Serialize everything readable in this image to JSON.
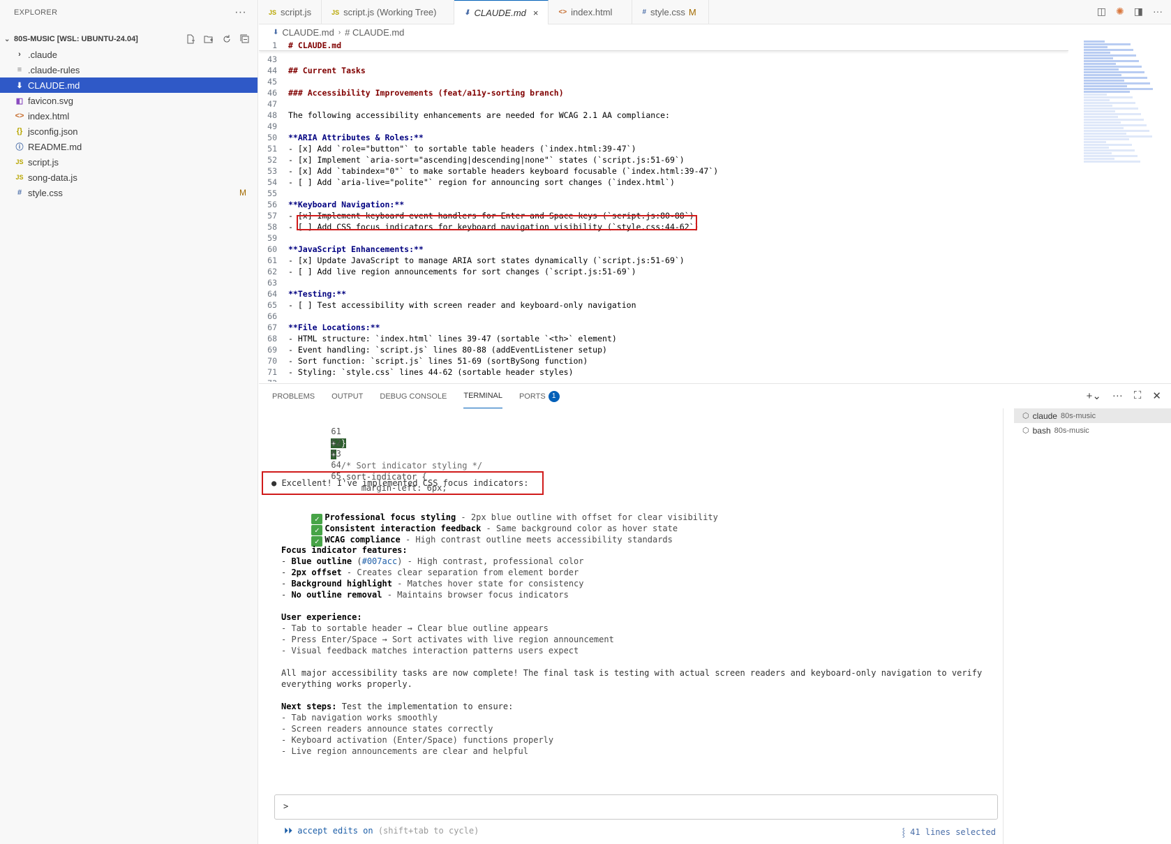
{
  "sidebar": {
    "title": "EXPLORER",
    "more": "···",
    "workspace": "80S-MUSIC [WSL: UBUNTU-24.04]",
    "items": [
      {
        "label": ".claude",
        "icon": "chevron-right"
      },
      {
        "label": ".claude-rules",
        "icon": "rules-file"
      },
      {
        "label": "CLAUDE.md",
        "icon": "markdown-file",
        "selected": true
      },
      {
        "label": "favicon.svg",
        "icon": "svg-file"
      },
      {
        "label": "index.html",
        "icon": "html-file"
      },
      {
        "label": "jsconfig.json",
        "icon": "json-file"
      },
      {
        "label": "README.md",
        "icon": "info-file"
      },
      {
        "label": "script.js",
        "icon": "js-file"
      },
      {
        "label": "song-data.js",
        "icon": "js-file"
      },
      {
        "label": "style.css",
        "icon": "css-file",
        "badge": "M"
      }
    ]
  },
  "tabs": [
    {
      "label": "script.js",
      "icon": "JS"
    },
    {
      "label": "script.js (Working Tree)",
      "icon": "JS"
    },
    {
      "label": "CLAUDE.md",
      "icon": "md",
      "active": true,
      "close": "×"
    },
    {
      "label": "index.html",
      "icon": "<>"
    },
    {
      "label": "style.css",
      "icon": "#",
      "badge": "M"
    }
  ],
  "breadcrumb": {
    "file": "CLAUDE.md",
    "symbol": "# CLAUDE.md"
  },
  "editor": {
    "sticky": {
      "n": "1",
      "text": "# CLAUDE.md"
    },
    "lines": [
      {
        "n": "43",
        "text": "",
        "style": ""
      },
      {
        "n": "44",
        "text": "## Current Tasks",
        "style": "head"
      },
      {
        "n": "45",
        "text": "",
        "style": ""
      },
      {
        "n": "46",
        "text": "### Accessibility Improvements (feat/a11y-sorting branch)",
        "style": "head"
      },
      {
        "n": "47",
        "text": "",
        "style": ""
      },
      {
        "n": "48",
        "text": "The following accessibility enhancements are needed for WCAG 2.1 AA compliance:",
        "style": ""
      },
      {
        "n": "49",
        "text": "",
        "style": ""
      },
      {
        "n": "50",
        "text": "**ARIA Attributes & Roles:**",
        "style": "bold"
      },
      {
        "n": "51",
        "text": "- [x] Add `role=\"button\"` to sortable table headers (`index.html:39-47`)",
        "style": ""
      },
      {
        "n": "52",
        "text": "- [x] Implement `aria-sort=\"ascending|descending|none\"` states (`script.js:51-69`)",
        "style": ""
      },
      {
        "n": "53",
        "text": "- [x] Add `tabindex=\"0\"` to make sortable headers keyboard focusable (`index.html:39-47`)",
        "style": ""
      },
      {
        "n": "54",
        "text": "- [ ] Add `aria-live=\"polite\"` region for announcing sort changes (`index.html`)",
        "style": ""
      },
      {
        "n": "55",
        "text": "",
        "style": ""
      },
      {
        "n": "56",
        "text": "**Keyboard Navigation:**",
        "style": "bold"
      },
      {
        "n": "57",
        "text": "- [x] Implement keyboard event handlers for Enter and Space keys (`script.js:80-88`)",
        "style": ""
      },
      {
        "n": "58",
        "text": "- [ ] Add CSS focus indicators for keyboard navigation visibility (`style.css:44-62`)",
        "style": ""
      },
      {
        "n": "59",
        "text": "",
        "style": ""
      },
      {
        "n": "60",
        "text": "**JavaScript Enhancements:**",
        "style": "bold"
      },
      {
        "n": "61",
        "text": "- [x] Update JavaScript to manage ARIA sort states dynamically (`script.js:51-69`)",
        "style": ""
      },
      {
        "n": "62",
        "text": "- [ ] Add live region announcements for sort changes (`script.js:51-69`)",
        "style": ""
      },
      {
        "n": "63",
        "text": "",
        "style": ""
      },
      {
        "n": "64",
        "text": "**Testing:**",
        "style": "bold"
      },
      {
        "n": "65",
        "text": "- [ ] Test accessibility with screen reader and keyboard-only navigation",
        "style": ""
      },
      {
        "n": "66",
        "text": "",
        "style": ""
      },
      {
        "n": "67",
        "text": "**File Locations:**",
        "style": "bold"
      },
      {
        "n": "68",
        "text": "- HTML structure: `index.html` lines 39-47 (sortable `<th>` element)",
        "style": ""
      },
      {
        "n": "69",
        "text": "- Event handling: `script.js` lines 80-88 (addEventListener setup)",
        "style": ""
      },
      {
        "n": "70",
        "text": "- Sort function: `script.js` lines 51-69 (sortBySong function)",
        "style": ""
      },
      {
        "n": "71",
        "text": "- Styling: `style.css` lines 44-62 (sortable header styles)",
        "style": ""
      },
      {
        "n": "72",
        "text": "",
        "style": ""
      }
    ]
  },
  "panel": {
    "tabs": [
      "PROBLEMS",
      "OUTPUT",
      "DEBUG CONSOLE",
      "TERMINAL",
      "PORTS"
    ],
    "active_tab": "TERMINAL",
    "ports_count": "1",
    "terminals": [
      {
        "name": "claude",
        "cwd": "80s-music",
        "active": true
      },
      {
        "name": "bash",
        "cwd": "80s-music",
        "active": false
      }
    ]
  },
  "terminal": {
    "diff": [
      {
        "n": "61",
        "text": "+ }"
      },
      {
        "n": "62",
        "text": "+"
      },
      {
        "n": "63",
        "text": "  /* Sort indicator styling */"
      },
      {
        "n": "64",
        "text": "  .sort-indicator {"
      },
      {
        "n": "65",
        "text": "      margin-left: 6px;"
      }
    ],
    "headline": "● Excellent! I've implemented CSS focus indicators:",
    "checks": [
      {
        "bold": "Professional focus styling",
        "rest": " - 2px blue outline with offset for clear visibility"
      },
      {
        "bold": "Consistent interaction feedback",
        "rest": " - Same background color as hover state"
      },
      {
        "bold": "WCAG compliance",
        "rest": " - High contrast outline meets accessibility standards"
      }
    ],
    "features_title": "Focus indicator features:",
    "features": [
      {
        "bold": "Blue outline",
        "mid": " (",
        "accent": "#007acc",
        "rest": ") - High contrast, professional color"
      },
      {
        "bold": "2px offset",
        "mid": "",
        "accent": "",
        "rest": " - Creates clear separation from element border"
      },
      {
        "bold": "Background highlight",
        "mid": "",
        "accent": "",
        "rest": " - Matches hover state for consistency"
      },
      {
        "bold": "No outline removal",
        "mid": "",
        "accent": "",
        "rest": " - Maintains browser focus indicators"
      }
    ],
    "ux_title": "User experience:",
    "ux": [
      "- Tab to sortable header → Clear blue outline appears",
      "- Press Enter/Space → Sort activates with live region announcement",
      "- Visual feedback matches interaction patterns users expect"
    ],
    "summary_1": "All major accessibility tasks are now complete! The final task is testing with actual screen readers and keyboard-only navigation to verify",
    "summary_2": "everything works properly.",
    "next_title": "Next steps:",
    "next_rest": " Test the implementation to ensure:",
    "next": [
      "- Tab navigation works smoothly",
      "- Screen readers announce states correctly",
      "- Keyboard activation (Enter/Space) functions properly",
      "- Live region announcements are clear and helpful"
    ],
    "prompt": ">",
    "status_left_main": "⏵⏵ accept edits on",
    "status_left_hint": " (shift+tab to cycle)",
    "status_right": "⸾ 41 lines selected"
  }
}
